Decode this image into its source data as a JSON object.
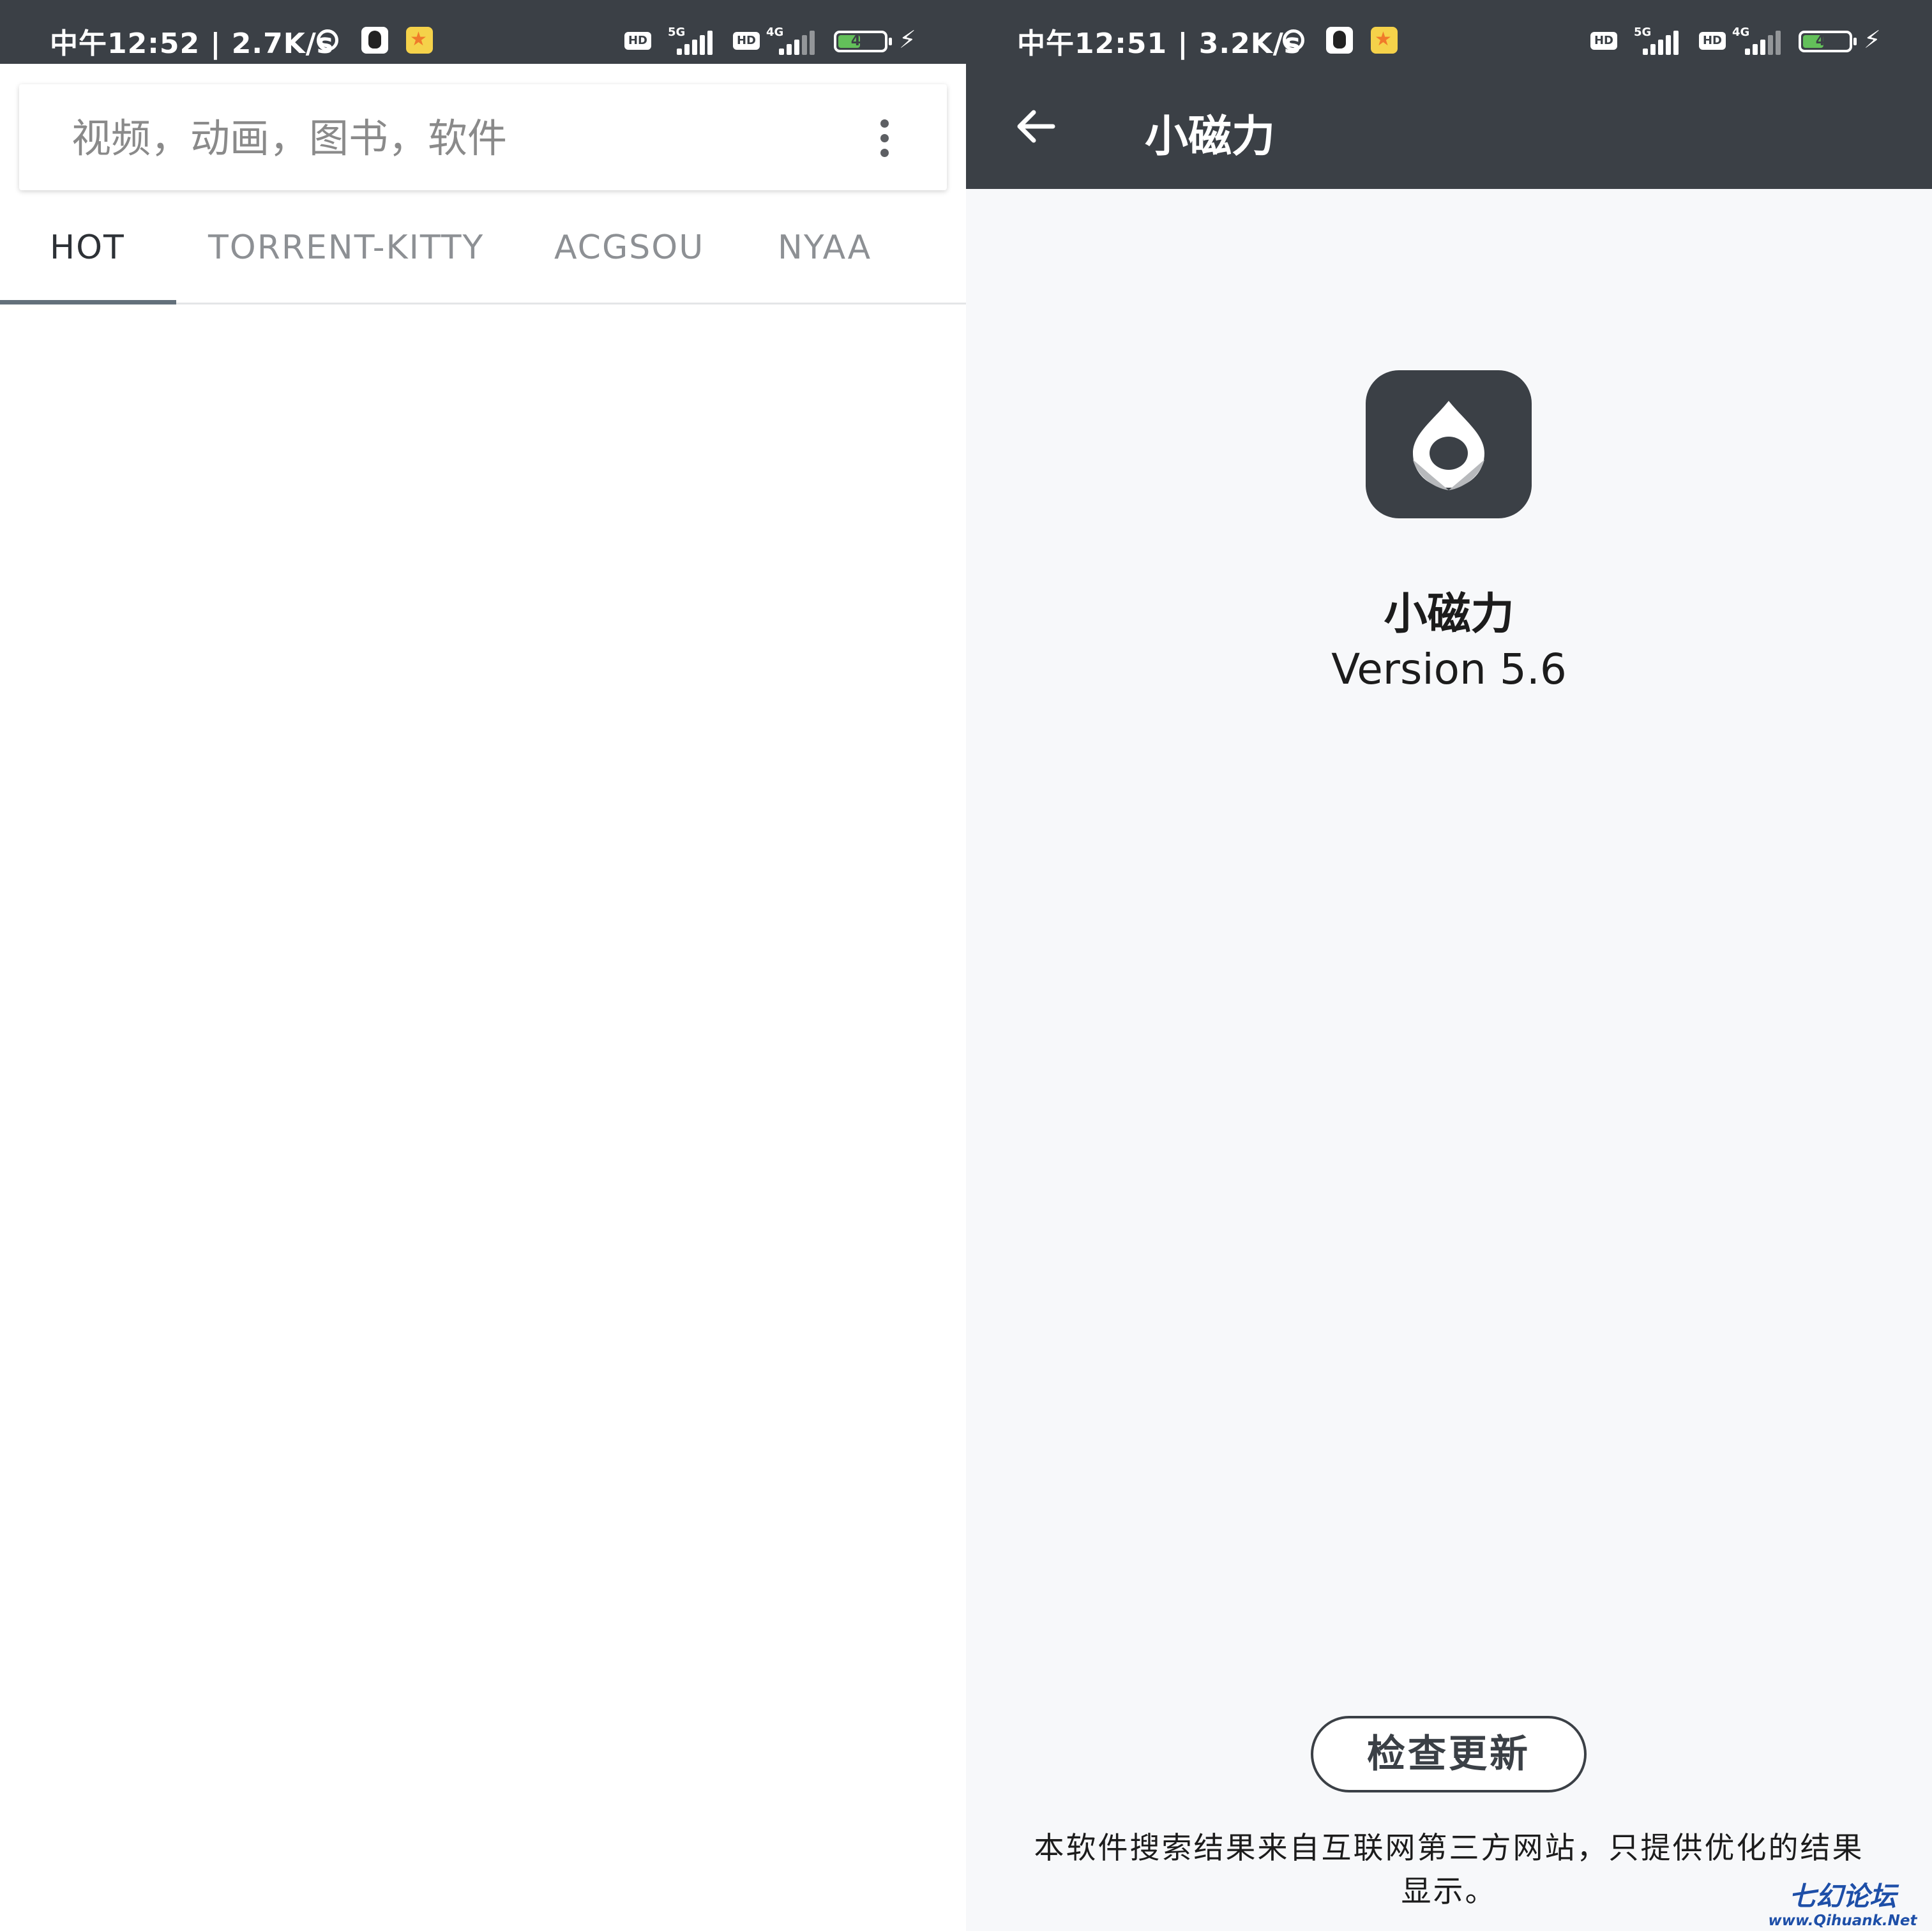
{
  "left": {
    "status_bar": {
      "time_speed": "中午12:52 | 2.7K/s",
      "network_5g": "5G",
      "network_4g": "4G",
      "hd_label": "HD",
      "battery": "47"
    },
    "search": {
      "placeholder": "视频，动画，图书，软件",
      "menu_icon": "more-vertical-icon"
    },
    "tabs": [
      {
        "label": "HOT",
        "active": true
      },
      {
        "label": "TORRENT-KITTY",
        "active": false
      },
      {
        "label": "ACGSOU",
        "active": false
      },
      {
        "label": "NYAA",
        "active": false
      }
    ]
  },
  "right": {
    "status_bar": {
      "time_speed": "中午12:51 | 3.2K/s",
      "network_5g": "5G",
      "network_4g": "4G",
      "hd_label": "HD",
      "battery": "45"
    },
    "app_bar": {
      "title": "小磁力",
      "back_icon": "arrow-left-icon"
    },
    "about": {
      "app_name": "小磁力",
      "version": "Version 5.6",
      "check_update_label": "检查更新",
      "disclaimer": "本软件搜索结果来自互联网第三方网站，只提供优化的结果显示。"
    }
  },
  "watermark": {
    "title": "七幻论坛",
    "url": "www.Qihuank.Net"
  },
  "colors": {
    "primary_dark": "#3b4046",
    "tab_indicator": "#63707b",
    "battery_green": "#63c05a",
    "watermark_blue": "#1e4fa8"
  }
}
